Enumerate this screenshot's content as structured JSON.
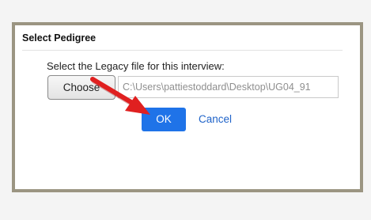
{
  "dialog": {
    "title": "Select Pedigree",
    "prompt": "Select the Legacy file for this interview:",
    "choose_label": "Choose",
    "file_path": "C:\\Users\\pattiestoddard\\Desktop\\UG04_91",
    "ok_label": "OK",
    "cancel_label": "Cancel"
  },
  "colors": {
    "ok_button": "#1f73e8",
    "cancel_link": "#1f63c9",
    "dialog_border": "#9b9582",
    "annotation_arrow": "#e02020"
  },
  "icons": {
    "annotation": "red-arrow-icon"
  }
}
